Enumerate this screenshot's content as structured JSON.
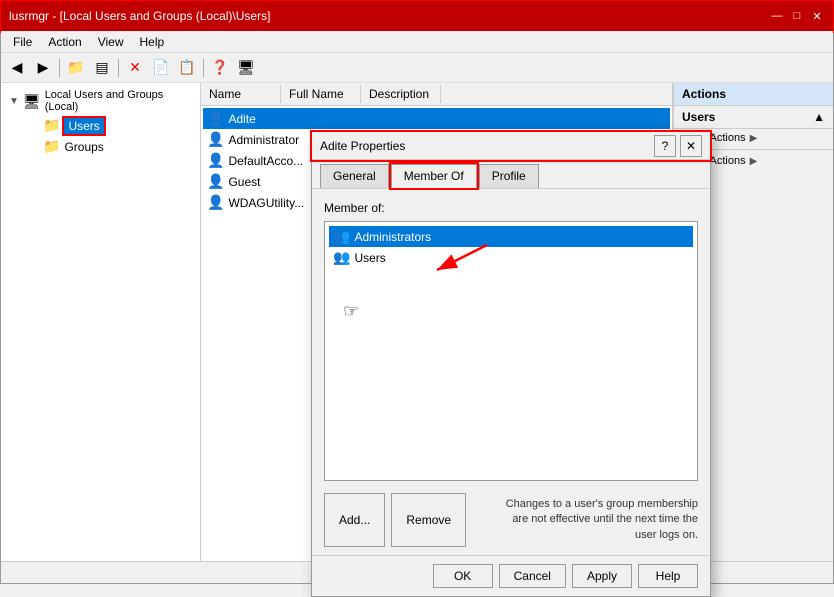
{
  "window": {
    "title": "lusrmgr - [Local Users and Groups (Local)\\Users]"
  },
  "title_bar_buttons": {
    "minimize": "—",
    "maximize": "□",
    "close": "✕"
  },
  "menu_bar": {
    "items": [
      "File",
      "Action",
      "View",
      "Help"
    ]
  },
  "toolbar": {
    "buttons": [
      "←",
      "→",
      "📁",
      "📋",
      "✕",
      "📄",
      "📋",
      "❓",
      "🖥"
    ]
  },
  "left_panel": {
    "root_label": "Local Users and Groups (Local)",
    "items": [
      {
        "label": "Users",
        "selected": true
      },
      {
        "label": "Groups",
        "selected": false
      }
    ]
  },
  "center_panel": {
    "headers": [
      "Name",
      "Full Name",
      "Description"
    ],
    "rows": [
      {
        "label": "Adite",
        "selected": true
      },
      {
        "label": "Administrator"
      },
      {
        "label": "DefaultAcco..."
      },
      {
        "label": "Guest"
      },
      {
        "label": "WDAGUtility..."
      }
    ]
  },
  "right_panel": {
    "title": "Actions",
    "users_label": "Users",
    "items": [
      "More Actions ▶",
      "More Actions ▶"
    ]
  },
  "modal": {
    "title": "Adite Properties",
    "help_char": "?",
    "close_char": "✕",
    "tabs": [
      "General",
      "Member Of",
      "Profile"
    ],
    "active_tab": "Member Of",
    "member_of_label": "Member of:",
    "members": [
      {
        "label": "Administrators",
        "selected": true
      },
      {
        "label": "Users",
        "selected": false
      }
    ],
    "add_btn": "Add...",
    "remove_btn": "Remove",
    "footer_info": "Changes to a user's group membership are not effective until the next time the user logs on.",
    "ok_btn": "OK",
    "cancel_btn": "Cancel",
    "apply_btn": "Apply",
    "help_btn": "Help"
  }
}
